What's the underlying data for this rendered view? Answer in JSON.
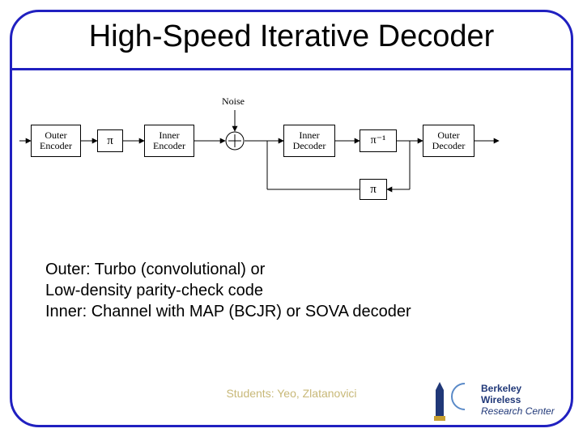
{
  "title": "High-Speed Iterative Decoder",
  "diagram": {
    "noise_label": "Noise",
    "blocks": {
      "outer_encoder": "Outer\nEncoder",
      "pi1": "π",
      "inner_encoder": "Inner\nEncoder",
      "inner_decoder": "Inner\nDecoder",
      "pi_inv": "π⁻¹",
      "outer_decoder": "Outer\nDecoder",
      "pi_feedback": "π"
    }
  },
  "description": {
    "line1": "Outer: Turbo (convolutional) or",
    "line2": " Low-density parity-check code",
    "line3": "Inner: Channel with MAP (BCJR) or SOVA decoder"
  },
  "students": "Students: Yeo, Zlatanovici",
  "logo": {
    "line1": "Berkeley Wireless",
    "line2": "Research Center"
  }
}
